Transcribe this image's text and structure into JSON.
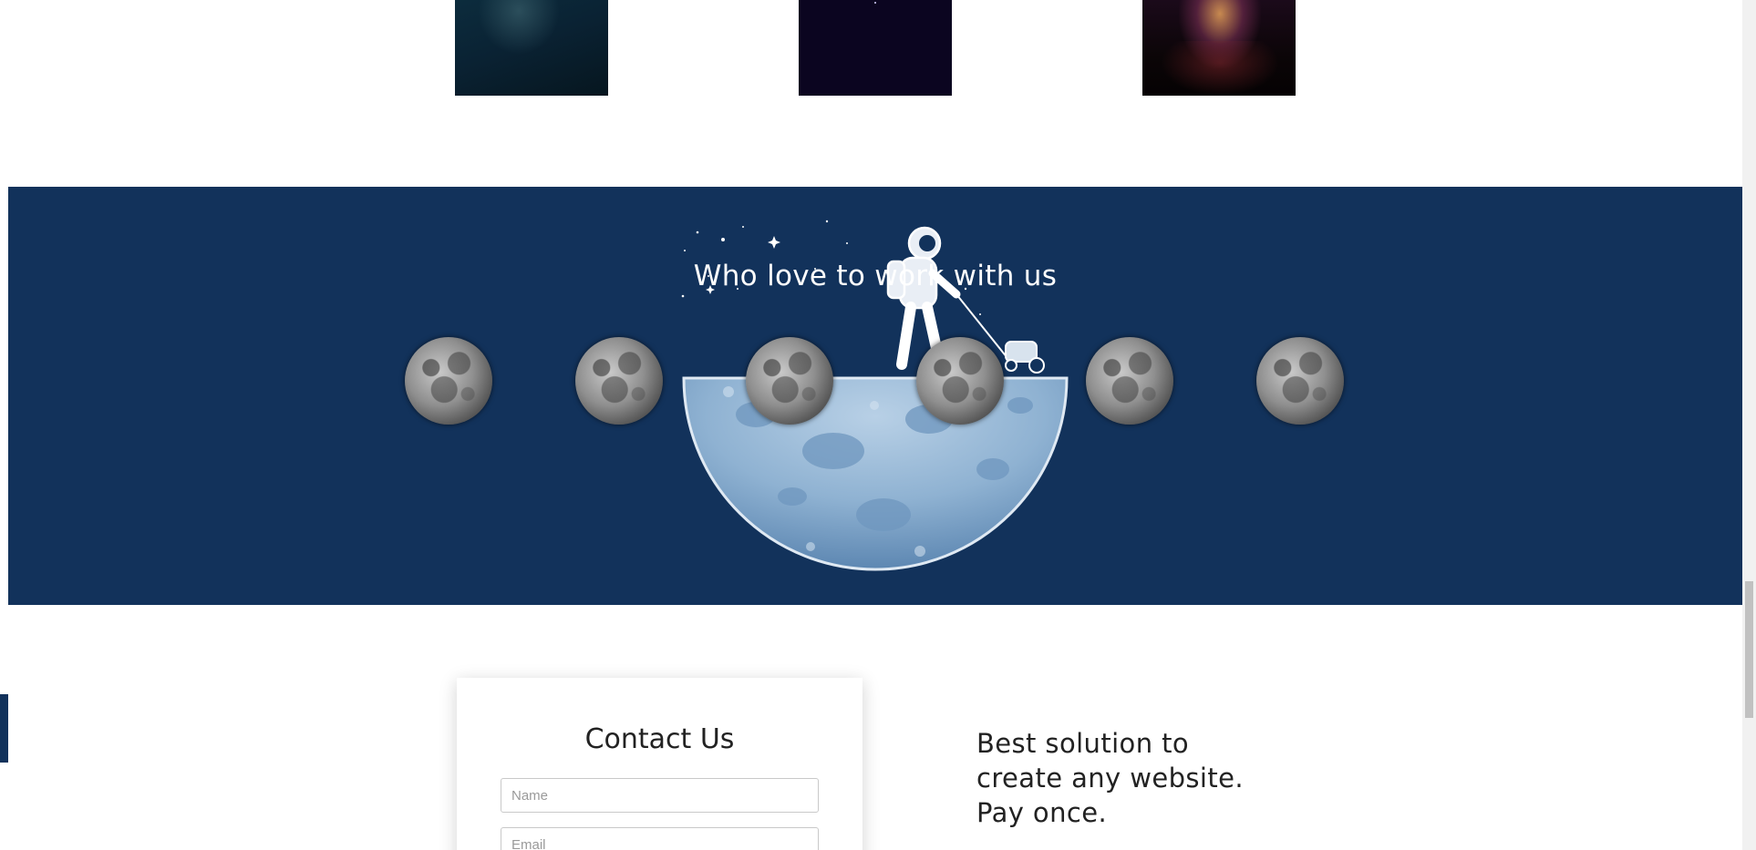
{
  "gallery": {
    "images": [
      {
        "name": "gallery-image-1"
      },
      {
        "name": "gallery-image-2"
      },
      {
        "name": "gallery-image-3"
      }
    ]
  },
  "clients": {
    "title": "Who love to work with us",
    "logo_count": 6,
    "logo_icon": "moon-icon",
    "background_color": "#12325b"
  },
  "contact": {
    "title": "Contact Us",
    "name_placeholder": "Name",
    "email_placeholder": "Email"
  },
  "tagline": {
    "lines": [
      "Best solution to",
      "create any website.",
      "Pay once."
    ]
  }
}
